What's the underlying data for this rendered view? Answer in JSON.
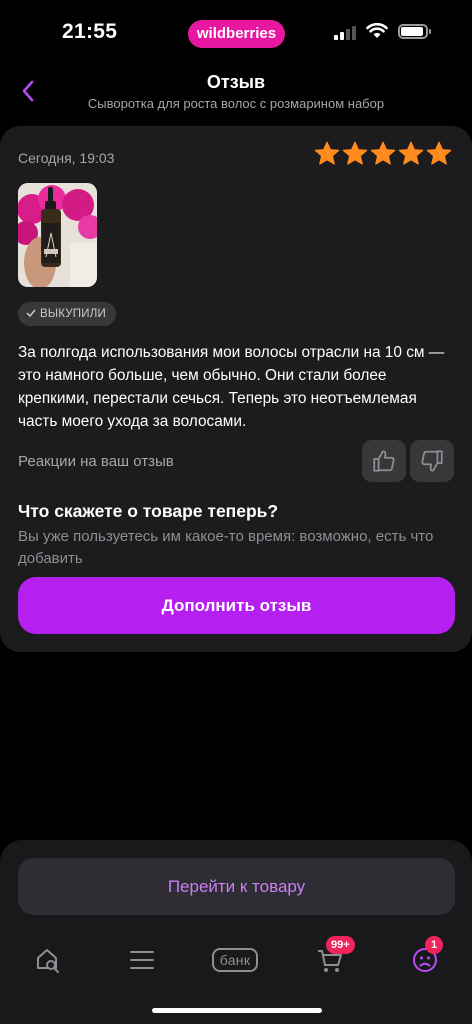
{
  "status_bar": {
    "time": "21:55",
    "brand": "wildberries"
  },
  "header": {
    "title": "Отзыв",
    "subtitle": "Сыворотка для роста волос с розмарином набор",
    "back_icon": "chevron-left-icon"
  },
  "review": {
    "date": "Сегодня, 19:03",
    "rating": 5,
    "rating_max": 5,
    "badge": "ВЫКУПИЛИ",
    "text": "За полгода использования мои волосы отрасли на 10 см — это намного больше, чем обычно. Они стали более крепкими, перестали сечься. Теперь это неотъемлемая часть моего ухода за волосами.",
    "reactions_label": "Реакции на ваш отзыв",
    "prompt_title": "Что скажете о товаре теперь?",
    "prompt_text": "Вы уже пользуетесь им какое-то время: возможно, есть что добавить",
    "action_label": "Дополнить отзыв"
  },
  "bottom": {
    "goto_label": "Перейти к товару",
    "tabs": [
      {
        "icon": "home-search-icon"
      },
      {
        "icon": "menu-icon"
      },
      {
        "label": "банк"
      },
      {
        "icon": "cart-icon",
        "badge": "99+"
      },
      {
        "icon": "profile-icon",
        "badge": "1"
      }
    ]
  },
  "colors": {
    "accent": "#b51ff0",
    "brand": "#e8179f",
    "star": "#ff8a1e",
    "badge": "#f0245b",
    "link": "#c97ef5"
  }
}
